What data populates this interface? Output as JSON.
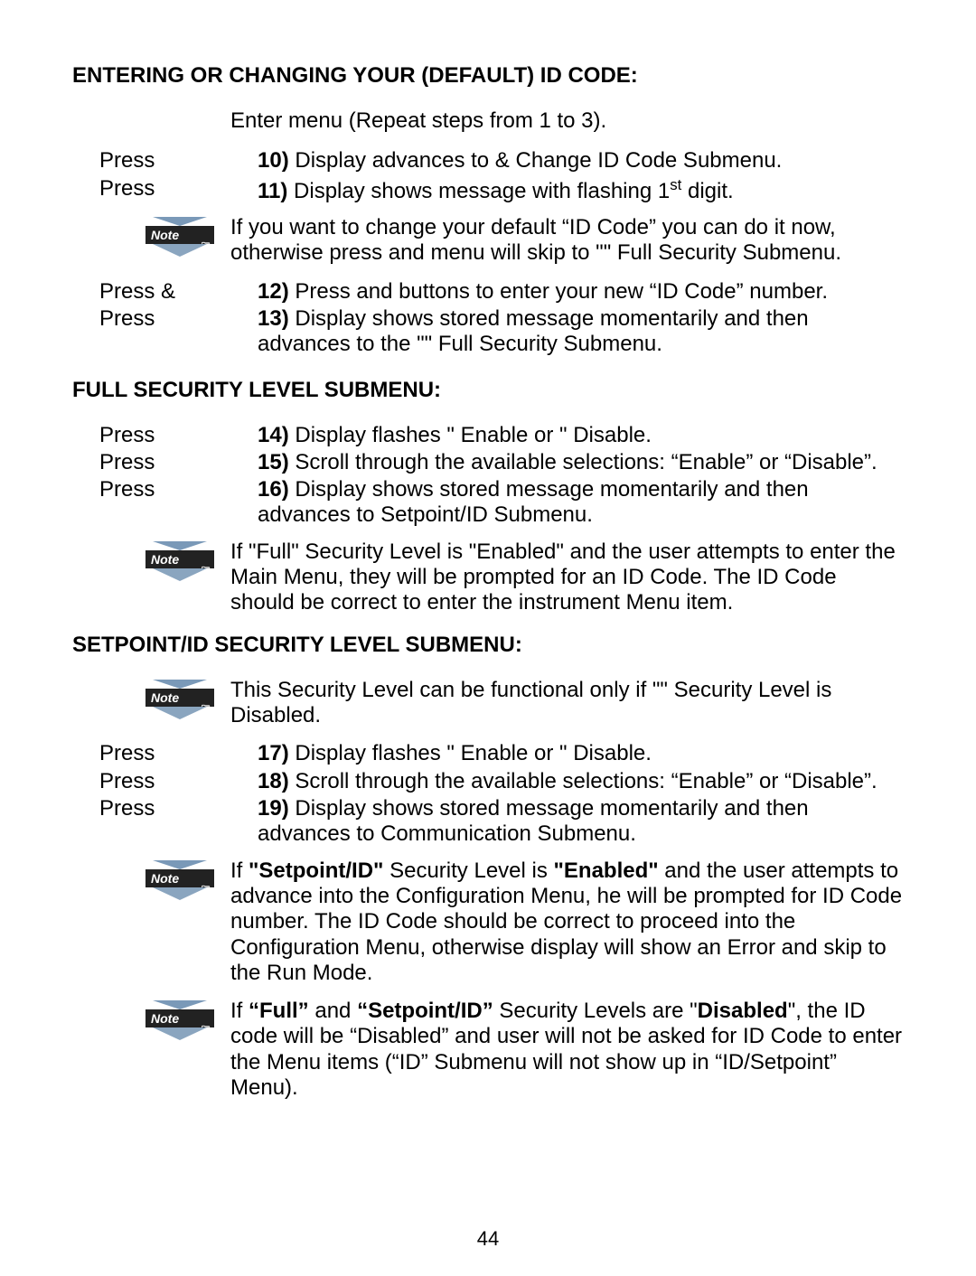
{
  "page_number": "44",
  "h1": "ENTERING OR CHANGING YOUR (DEFAULT) ID CODE:",
  "enter_line": "Enter     menu (Repeat steps from 1 to 3).",
  "r10_left": "Press",
  "r10_num": "10) ",
  "r10_text": "Display advances to  &        Change ID Code Submenu.",
  "r11_left": "Press",
  "r11_num": "11) ",
  "r11_text_a": "Display shows          message with flashing 1",
  "r11_text_b": " digit.",
  "note1": "If you want to change your default “ID Code” you can do it now, otherwise press     and menu will skip to  \"\"     Full Security Submenu.",
  "r12_left": "Press       &",
  "r12_num": "12) ",
  "r12_text": "Press     and      buttons to enter your new “ID Code” number.",
  "r13_left": "Press",
  "r13_num": "13) ",
  "r13_text": "Display shows           stored message momentarily and then advances to the  \"\"       Full Security Submenu.",
  "h2": "FULL SECURITY LEVEL SUBMENU:",
  "r14_left": "Press",
  "r14_num": "14) ",
  "r14_text": "Display flashes   \"       Enable or   \"       Disable.",
  "r15_left": "Press",
  "r15_num": "15) ",
  "r15_text": "Scroll through the available selections: “Enable” or “Disable”.",
  "r16_left": "Press",
  "r16_num": "16) ",
  "r16_text": "Display shows           stored message momentarily and then advances to           Setpoint/ID Submenu.",
  "note2": "If \"Full\" Security Level is \"Enabled\" and the user attempts to enter the Main Menu, they will be prompted for an ID Code. The ID Code should be correct to enter the instrument Menu item.",
  "h3": "SETPOINT/ID SECURITY LEVEL SUBMENU:",
  "note3": "This Security Level can be functional only if  \"\"       Security Level is Disabled.",
  "r17_left": "Press",
  "r17_num": "17) ",
  "r17_text": "Display flashes   \"       Enable or   \"       Disable.",
  "r18_left": "Press",
  "r18_num": "18) ",
  "r18_text": "Scroll through the available selections: “Enable” or “Disable”.",
  "r19_left": "Press",
  "r19_num": "19) ",
  "r19_text": "Display shows           stored message momentarily and then advances to          Communication Submenu.",
  "note4_a": "If ",
  "note4_b": "\"Setpoint/ID\"",
  "note4_c": " Security Level is ",
  "note4_d": "\"Enabled\"",
  "note4_e": " and the user attempts to advance into the           Configuration Menu, he will be prompted for ID Code number. The ID Code should be correct to proceed into the Configuration Menu, otherwise display will show an Error and skip to the Run Mode.",
  "note5_a": "If ",
  "note5_b": "“Full”",
  "note5_c": " and ",
  "note5_d": "“Setpoint/ID”",
  "note5_e": " Security Levels are \"",
  "note5_f": "Disabled",
  "note5_g": "\", the ID code will be “Disabled” and user will not be asked for ID Code to enter the Menu items (“ID” Submenu will not show up in “ID/Setpoint” Menu).",
  "note_label": "Note"
}
